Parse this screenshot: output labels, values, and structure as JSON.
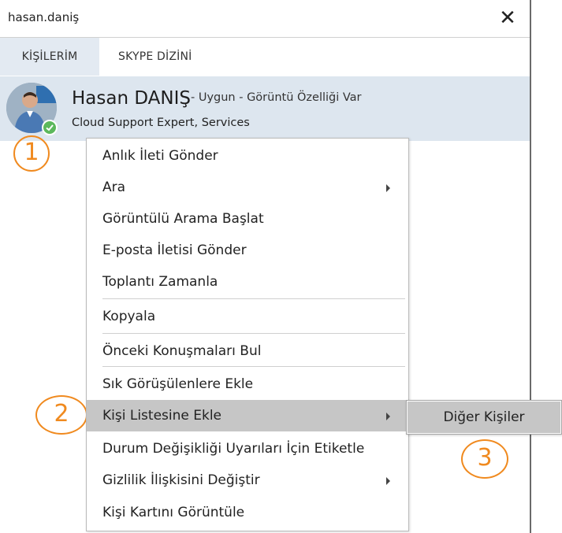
{
  "window": {
    "title": "hasan.daniş",
    "close_label": "✕"
  },
  "tabs": [
    {
      "label": "KİŞİLERİM",
      "active": true
    },
    {
      "label": "SKYPE DİZİNİ",
      "active": false
    }
  ],
  "contact": {
    "name": "Hasan DANIŞ",
    "status": "- Uygun - Görüntü Özelliği Var",
    "title": "Cloud Support Expert, Services",
    "presence_color": "#5cb85c"
  },
  "menu": {
    "items": [
      {
        "label": "Anlık İleti Gönder"
      },
      {
        "label": "Ara",
        "submenu": true
      },
      {
        "label": "Görüntülü Arama Başlat"
      },
      {
        "label": "E-posta İletisi Gönder"
      },
      {
        "label": "Toplantı Zamanla"
      },
      {
        "label": "Kopyala"
      },
      {
        "label": "Önceki Konuşmaları Bul"
      },
      {
        "label": "Sık Görüşülenlere Ekle"
      },
      {
        "label": "Kişi Listesine Ekle",
        "submenu": true,
        "highlighted": true
      },
      {
        "label": "Durum Değişikliği Uyarıları İçin Etiketle"
      },
      {
        "label": "Gizlilik İlişkisini Değiştir",
        "submenu": true
      },
      {
        "label": "Kişi Kartını Görüntüle"
      }
    ]
  },
  "submenu": {
    "items": [
      {
        "label": "Diğer Kişiler"
      }
    ]
  },
  "annotations": [
    "1",
    "2",
    "3"
  ],
  "colors": {
    "accent": "#f08a1f",
    "highlight": "#c6c6c6",
    "contact_row": "#dde6ef"
  }
}
